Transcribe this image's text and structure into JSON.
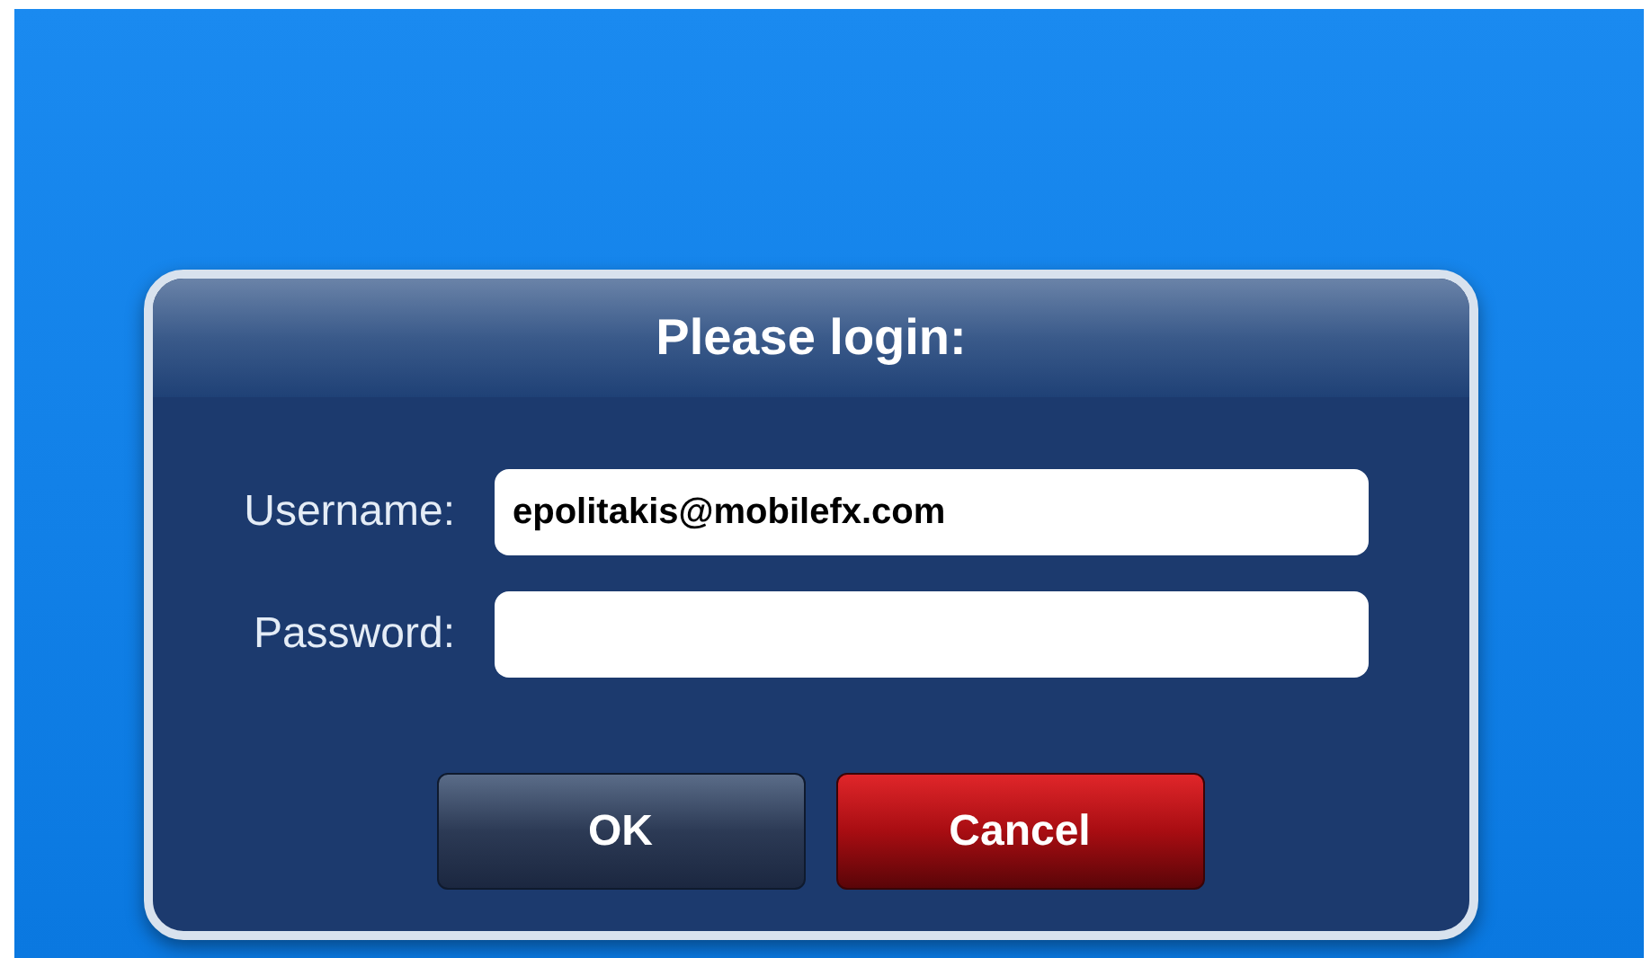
{
  "dialog": {
    "title": "Please login:"
  },
  "fields": [
    {
      "label": "Username:",
      "value": "epolitakis@mobilefx.com"
    },
    {
      "label": "Password:"
    }
  ],
  "buttons": [
    {
      "label": "OK",
      "kind": "default"
    },
    {
      "label": "Cancel",
      "kind": "danger"
    }
  ]
}
